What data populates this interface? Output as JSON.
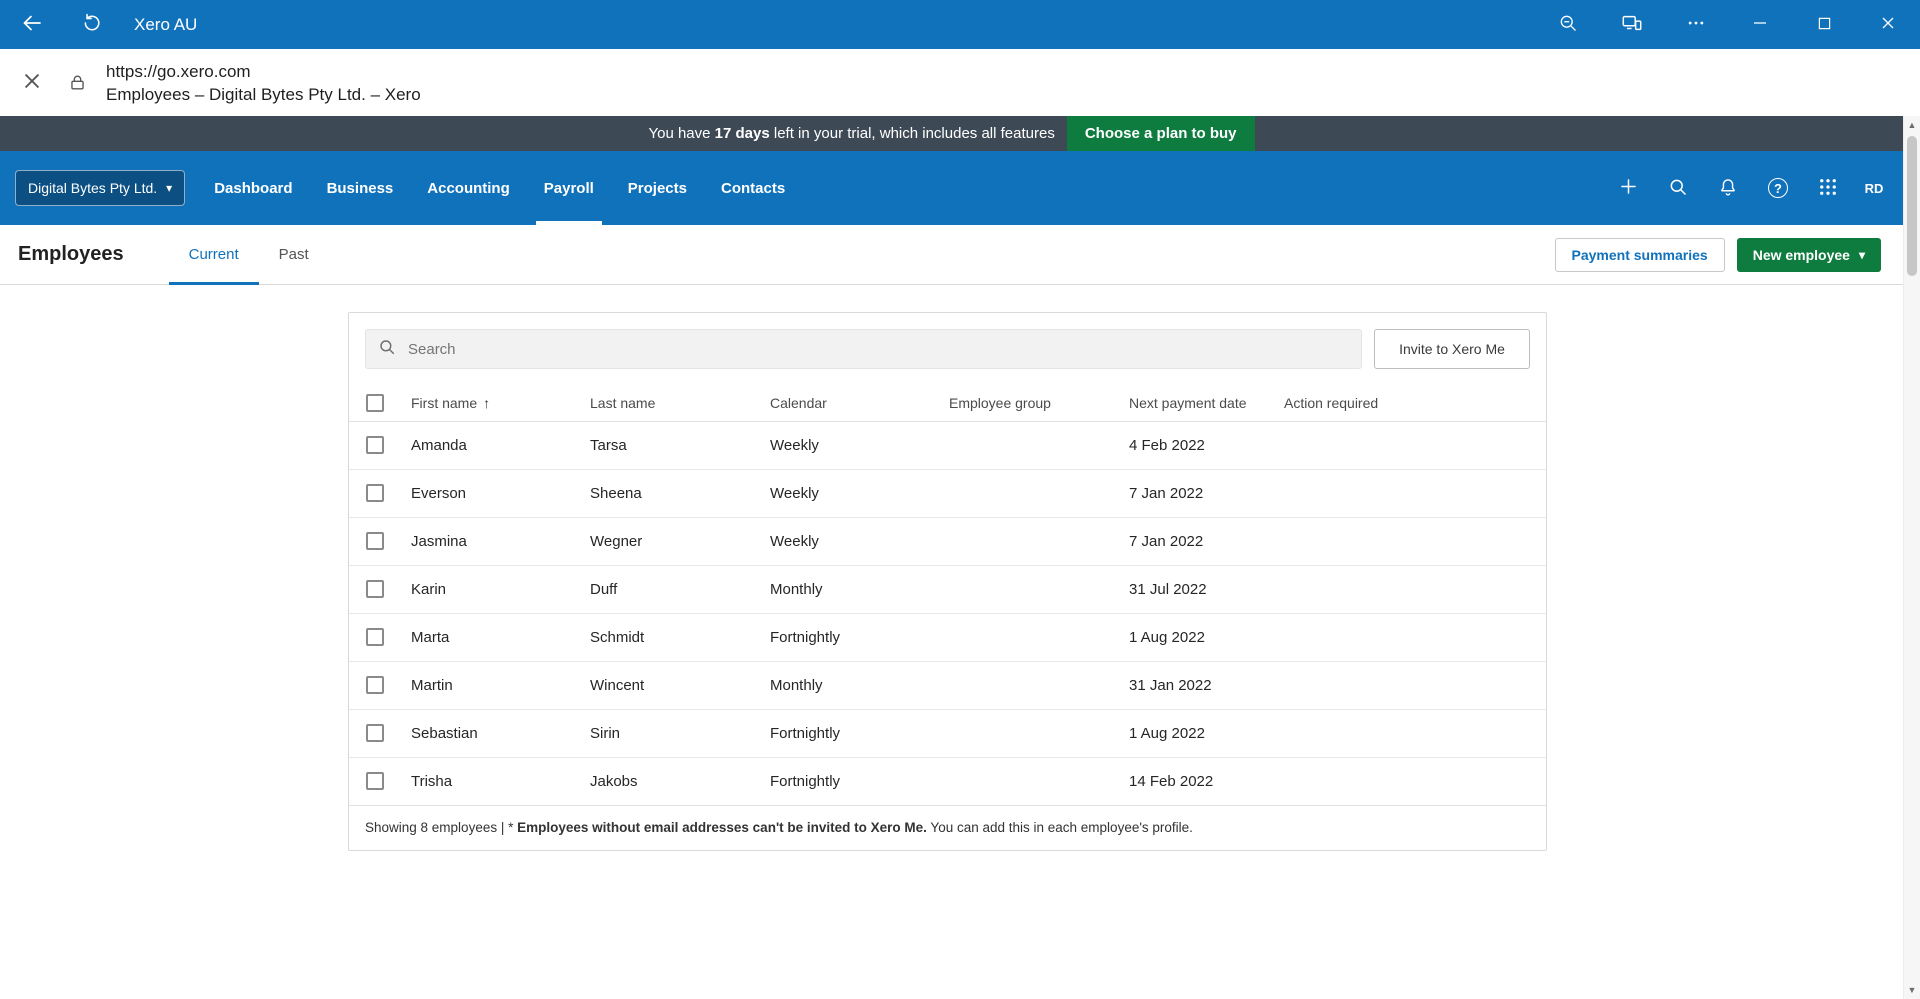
{
  "colors": {
    "nav_blue": "#1172BC",
    "green": "#0E7C3F",
    "banner_bg": "#3E4956",
    "avatar_bg": "#15395B"
  },
  "titlebar": {
    "title": "Xero AU"
  },
  "urlbar": {
    "url": "https://go.xero.com",
    "page_title": "Employees – Digital Bytes Pty Ltd. – Xero"
  },
  "trial_banner": {
    "text_before": "You have ",
    "days": "17 days",
    "text_after": " left in your trial, which includes all features",
    "cta": "Choose a plan to buy"
  },
  "nav": {
    "org": "Digital Bytes Pty Ltd.",
    "items": [
      {
        "label": "Dashboard",
        "active": false
      },
      {
        "label": "Business",
        "active": false
      },
      {
        "label": "Accounting",
        "active": false
      },
      {
        "label": "Payroll",
        "active": true
      },
      {
        "label": "Projects",
        "active": false
      },
      {
        "label": "Contacts",
        "active": false
      }
    ],
    "avatar": "RD"
  },
  "page_header": {
    "title": "Employees",
    "tabs": [
      {
        "label": "Current",
        "active": true
      },
      {
        "label": "Past",
        "active": false
      }
    ],
    "payment_summaries": "Payment summaries",
    "new_employee": "New employee"
  },
  "content": {
    "search_placeholder": "Search",
    "invite_button": "Invite to Xero Me",
    "table": {
      "headers": [
        "First name",
        "Last name",
        "Calendar",
        "Employee group",
        "Next payment date",
        "Action required"
      ],
      "rows": [
        {
          "first": "Amanda",
          "last": "Tarsa",
          "calendar": "Weekly",
          "group": "",
          "next_payment": "4 Feb 2022",
          "action": ""
        },
        {
          "first": "Everson",
          "last": "Sheena",
          "calendar": "Weekly",
          "group": "",
          "next_payment": "7 Jan 2022",
          "action": ""
        },
        {
          "first": "Jasmina",
          "last": "Wegner",
          "calendar": "Weekly",
          "group": "",
          "next_payment": "7 Jan 2022",
          "action": ""
        },
        {
          "first": "Karin",
          "last": "Duff",
          "calendar": "Monthly",
          "group": "",
          "next_payment": "31 Jul 2022",
          "action": ""
        },
        {
          "first": "Marta",
          "last": "Schmidt",
          "calendar": "Fortnightly",
          "group": "",
          "next_payment": "1 Aug 2022",
          "action": ""
        },
        {
          "first": "Martin",
          "last": "Wincent",
          "calendar": "Monthly",
          "group": "",
          "next_payment": "31 Jan 2022",
          "action": ""
        },
        {
          "first": "Sebastian",
          "last": "Sirin",
          "calendar": "Fortnightly",
          "group": "",
          "next_payment": "1 Aug 2022",
          "action": ""
        },
        {
          "first": "Trisha",
          "last": "Jakobs",
          "calendar": "Fortnightly",
          "group": "",
          "next_payment": "14 Feb 2022",
          "action": ""
        }
      ]
    },
    "footer": {
      "prefix": "Showing 8 employees | * ",
      "bold": "Employees without email addresses can't be invited to Xero Me.",
      "suffix": " You can add this in each employee's profile."
    }
  },
  "icons": {
    "caret_down": "▾",
    "sort_asc": "↑",
    "help": "?",
    "scroll_up": "▲",
    "scroll_down": "▼"
  }
}
